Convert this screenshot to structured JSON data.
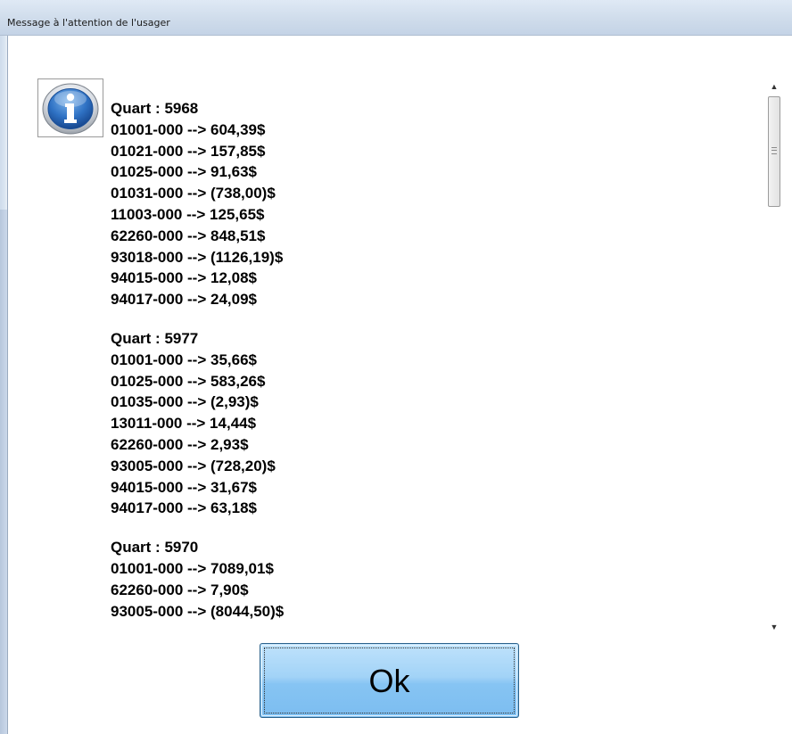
{
  "window": {
    "title": "Message à l'attention de l'usager"
  },
  "icon": {
    "name": "info-icon",
    "glyph": "i",
    "color": "#1f5fa8"
  },
  "message": {
    "blocks": [
      {
        "header": "Quart : 5968",
        "lines": [
          "01001-000 --> 604,39$",
          "01021-000 --> 157,85$",
          "01025-000 --> 91,63$",
          "01031-000 --> (738,00)$",
          "11003-000 --> 125,65$",
          "62260-000 --> 848,51$",
          "93018-000 --> (1126,19)$",
          "94015-000 --> 12,08$",
          "94017-000 --> 24,09$"
        ]
      },
      {
        "header": "Quart : 5977",
        "lines": [
          "01001-000 --> 35,66$",
          "01025-000 --> 583,26$",
          "01035-000 --> (2,93)$",
          "13011-000 --> 14,44$",
          "62260-000 --> 2,93$",
          "93005-000 --> (728,20)$",
          "94015-000 --> 31,67$",
          "94017-000 --> 63,18$"
        ]
      },
      {
        "header": "Quart : 5970",
        "lines": [
          "01001-000 --> 7089,01$",
          "62260-000 --> 7,90$",
          "93005-000 --> (8044,50)$"
        ]
      }
    ]
  },
  "scrollbar": {
    "up_glyph": "▲",
    "down_glyph": "▼"
  },
  "buttons": {
    "ok_label": "Ok"
  },
  "colors": {
    "button_fill": "#86c4f3",
    "title_bar": "#cfdceb"
  }
}
